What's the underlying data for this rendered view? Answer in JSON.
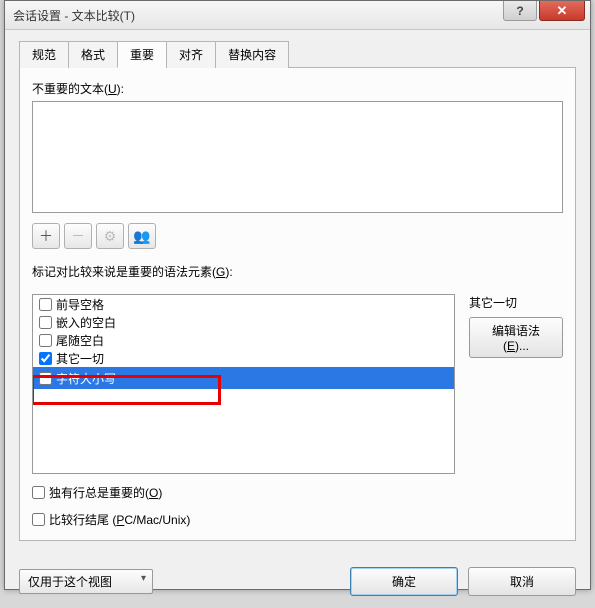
{
  "window": {
    "title": "会话设置 - 文本比较(T)"
  },
  "tabs": {
    "spec": "规范",
    "format": "格式",
    "important": "重要",
    "align": "对齐",
    "replace": "替换内容"
  },
  "labels": {
    "unimportant_text_prefix": "不重要的文本(",
    "unimportant_text_key": "U",
    "unimportant_text_suffix": "):",
    "grammar_prefix": "标记对比较来说是重要的语法元素(",
    "grammar_key": "G",
    "grammar_suffix": "):",
    "other_all": "其它一切",
    "edit_grammar_prefix": "编辑语法(",
    "edit_grammar_key": "E",
    "edit_grammar_suffix": ")...",
    "alone_rows_prefix": "独有行总是重要的(",
    "alone_rows_key": "O",
    "alone_rows_suffix": ")",
    "compare_eol_prefix": "比较行结尾 (",
    "compare_eol_key": "P",
    "compare_eol_suffix": "C/Mac/Unix)"
  },
  "list": {
    "leading_ws": "前导空格",
    "embedded_ws": "嵌入的空白",
    "trailing_ws": "尾随空白",
    "other_all": "其它一切",
    "case": "字符大小写"
  },
  "toolbar": {
    "plus": "＋",
    "minus": "－",
    "gear": "⚙",
    "people": "👥"
  },
  "footer": {
    "scope": "仅用于这个视图",
    "ok": "确定",
    "cancel": "取消"
  }
}
